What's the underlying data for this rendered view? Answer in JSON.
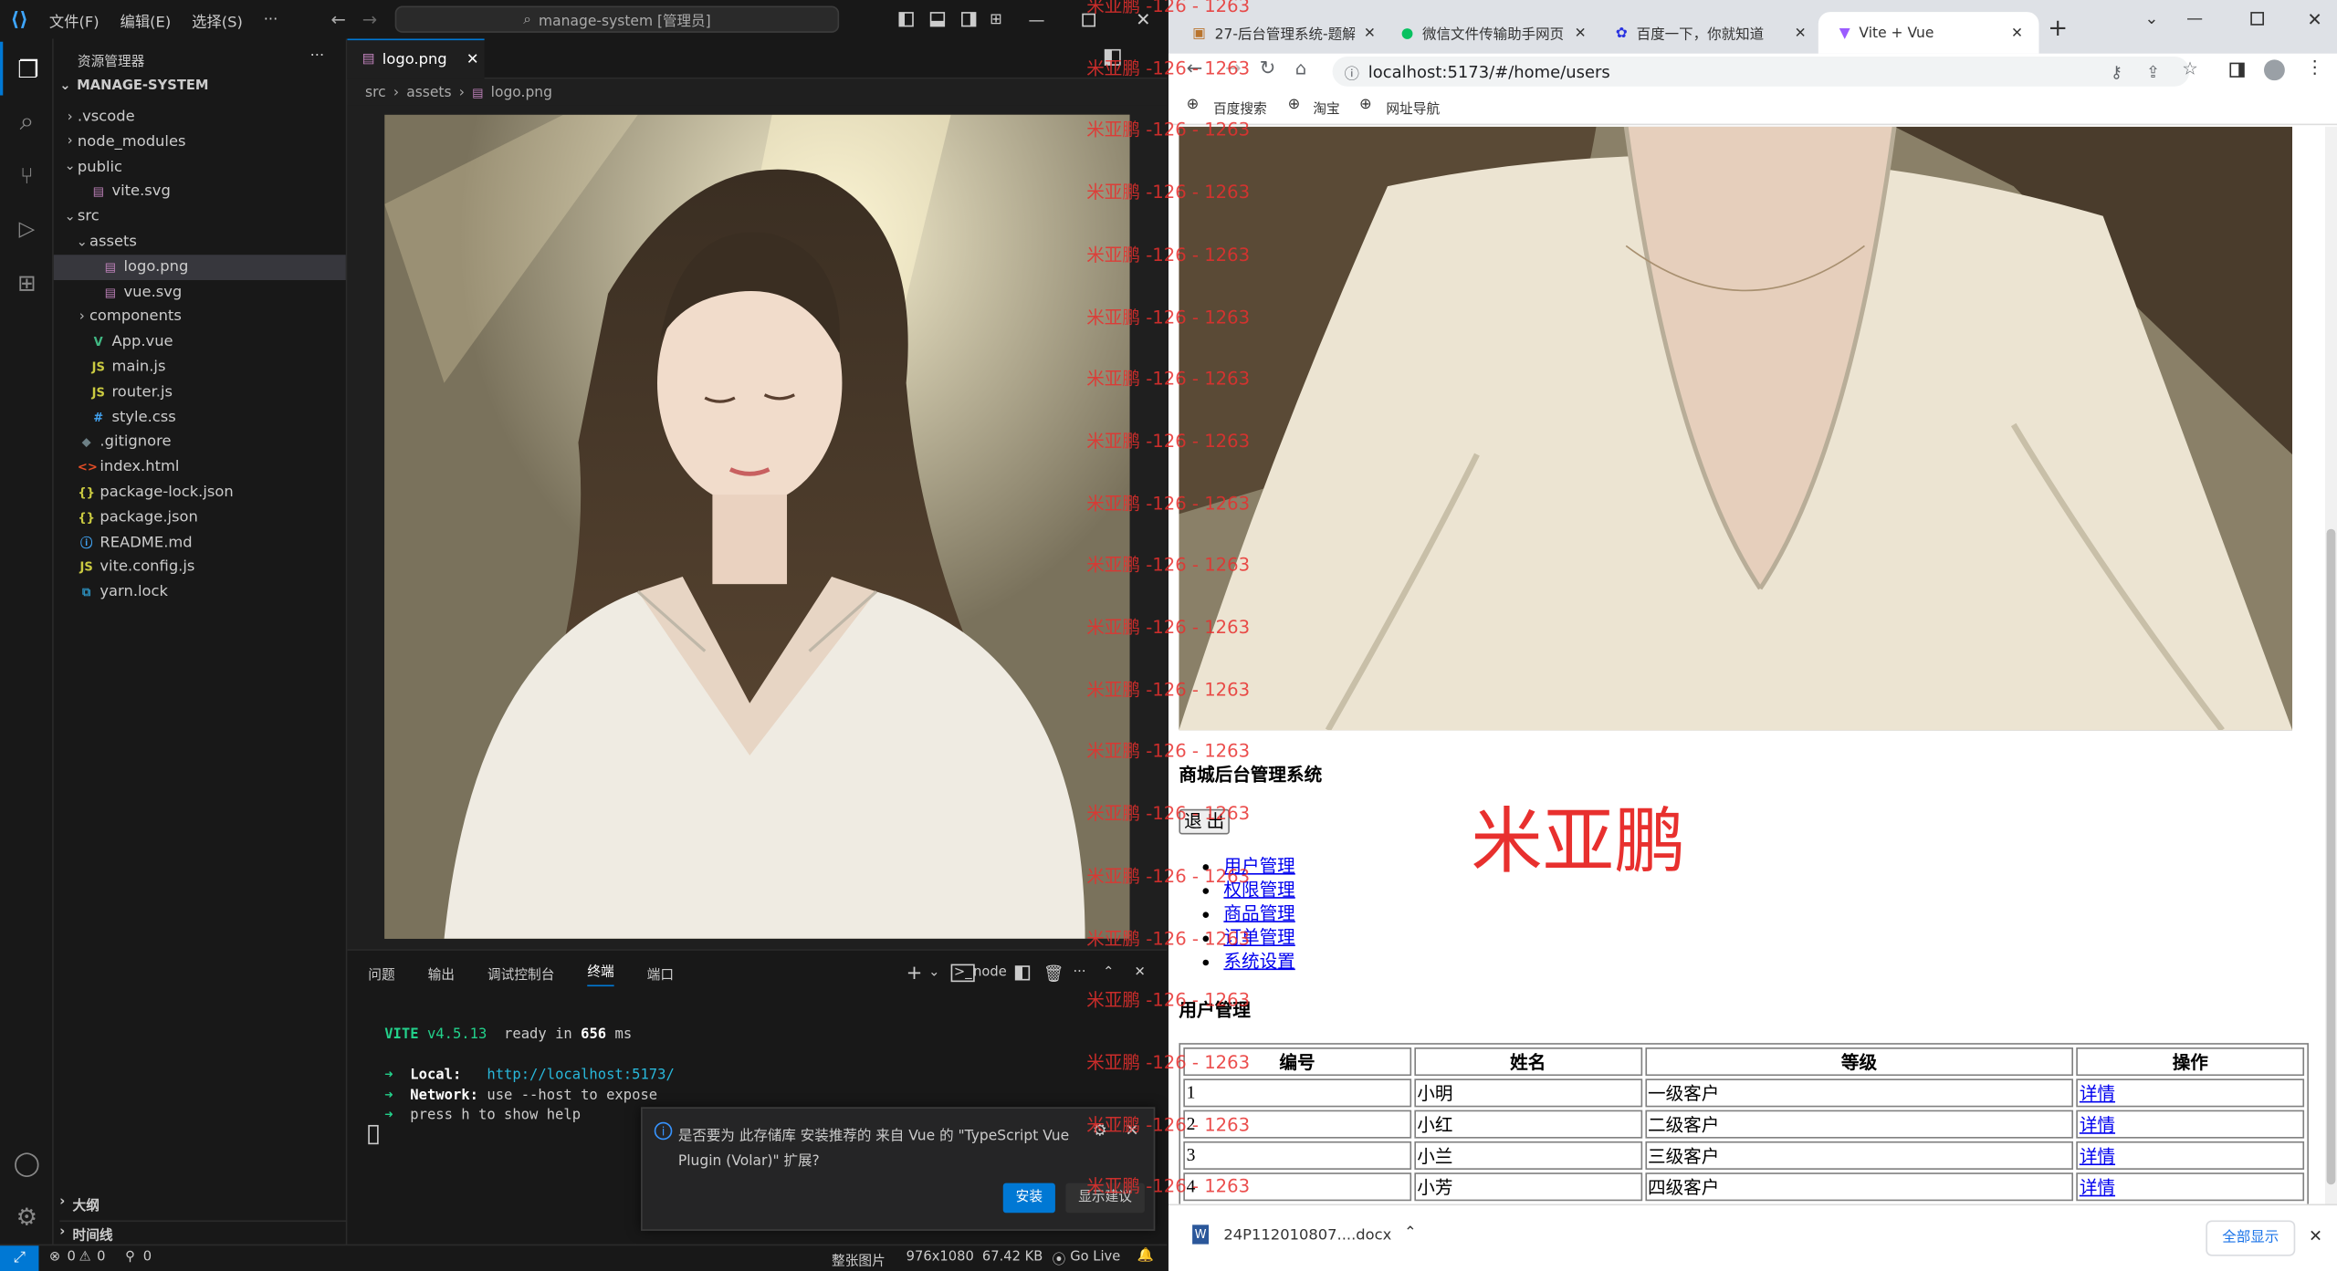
{
  "vscode": {
    "menus": [
      "文件(F)",
      "编辑(E)",
      "选择(S)",
      "···"
    ],
    "search_text": "manage-system [管理员]",
    "explorer_title": "资源管理器",
    "explorer_more": "···",
    "project_name": "MANAGE-SYSTEM",
    "tree": [
      {
        "label": ".vscode",
        "chev": "›",
        "indent": 0,
        "icon": "",
        "color": "#ccc"
      },
      {
        "label": "node_modules",
        "chev": "›",
        "indent": 0,
        "icon": "",
        "color": "#ccc"
      },
      {
        "label": "public",
        "chev": "⌄",
        "indent": 0,
        "icon": "",
        "color": "#ccc"
      },
      {
        "label": "vite.svg",
        "chev": "",
        "indent": 1,
        "icon": "▤",
        "color": "#c586c0"
      },
      {
        "label": "src",
        "chev": "⌄",
        "indent": 0,
        "icon": "",
        "color": "#ccc"
      },
      {
        "label": "assets",
        "chev": "⌄",
        "indent": 1,
        "icon": "",
        "color": "#ccc"
      },
      {
        "label": "logo.png",
        "chev": "",
        "indent": 2,
        "icon": "▤",
        "color": "#c586c0"
      },
      {
        "label": "vue.svg",
        "chev": "",
        "indent": 2,
        "icon": "▤",
        "color": "#c586c0"
      },
      {
        "label": "components",
        "chev": "›",
        "indent": 1,
        "icon": "",
        "color": "#ccc"
      },
      {
        "label": "App.vue",
        "chev": "",
        "indent": 1,
        "icon": "V",
        "color": "#41b883"
      },
      {
        "label": "main.js",
        "chev": "",
        "indent": 1,
        "icon": "JS",
        "color": "#cbcb41"
      },
      {
        "label": "router.js",
        "chev": "",
        "indent": 1,
        "icon": "JS",
        "color": "#cbcb41"
      },
      {
        "label": "style.css",
        "chev": "",
        "indent": 1,
        "icon": "#",
        "color": "#42a5f5"
      },
      {
        "label": ".gitignore",
        "chev": "",
        "indent": 0,
        "icon": "◆",
        "color": "#6d8086"
      },
      {
        "label": "index.html",
        "chev": "",
        "indent": 0,
        "icon": "<>",
        "color": "#e44d26"
      },
      {
        "label": "package-lock.json",
        "chev": "",
        "indent": 0,
        "icon": "{}",
        "color": "#cbcb41"
      },
      {
        "label": "package.json",
        "chev": "",
        "indent": 0,
        "icon": "{}",
        "color": "#cbcb41"
      },
      {
        "label": "README.md",
        "chev": "",
        "indent": 0,
        "icon": "ⓘ",
        "color": "#42a5f5"
      },
      {
        "label": "vite.config.js",
        "chev": "",
        "indent": 0,
        "icon": "JS",
        "color": "#cbcb41"
      },
      {
        "label": "yarn.lock",
        "chev": "",
        "indent": 0,
        "icon": "⧉",
        "color": "#2c8ebb"
      }
    ],
    "outline": "大纲",
    "timeline": "时间线",
    "tab_label": "logo.png",
    "breadcrumb": [
      "src",
      "assets",
      "logo.png"
    ],
    "panel_tabs": [
      "问题",
      "输出",
      "调试控制台",
      "终端",
      "端口"
    ],
    "panel_shell": "node",
    "terminal": {
      "vite": "VITE",
      "version": "v4.5.13",
      "ready": "ready in",
      "ms_value": "656",
      "ms_unit": "ms",
      "local_label": "Local:",
      "local_url": "http://localhost:5173/",
      "network_label": "Network:",
      "network_text": "use --host to expose",
      "help_text": "press h to show help"
    },
    "notification": {
      "line1": "是否要为 此存储库 安装推荐的 来自 Vue 的 \"TypeScript Vue",
      "line2": "Plugin (Volar)\" 扩展?",
      "install": "安装",
      "show": "显示建议"
    },
    "status": {
      "errors": "0",
      "warnings": "0",
      "ports": "0",
      "image_mode": "整张图片",
      "dimensions": "976x1080",
      "size": "67.42 KB",
      "golive": "Go Live"
    }
  },
  "chrome": {
    "tabs": [
      {
        "title": "27-后台管理系统-题解"
      },
      {
        "title": "微信文件传输助手网页"
      },
      {
        "title": "百度一下，你就知道"
      },
      {
        "title": "Vite + Vue"
      }
    ],
    "new_tab": "+",
    "url": "localhost:5173/#/home/users",
    "bookmarks": [
      "百度搜索",
      "淘宝",
      "网址导航"
    ],
    "download_file": "24P112010807....docx",
    "show_all": "全部显示"
  },
  "app": {
    "system_title": "商城后台管理系统",
    "logout": "退 出",
    "menu": [
      "用户管理",
      "权限管理",
      "商品管理",
      "订单管理",
      "系统设置"
    ],
    "section_title": "用户管理",
    "table_headers": [
      "编号",
      "姓名",
      "等级",
      "操作"
    ],
    "rows": [
      {
        "id": "1",
        "name": "小明",
        "level": "一级客户",
        "action": "详情"
      },
      {
        "id": "2",
        "name": "小红",
        "level": "二级客户",
        "action": "详情"
      },
      {
        "id": "3",
        "name": "小兰",
        "level": "三级客户",
        "action": "详情"
      },
      {
        "id": "4",
        "name": "小芳",
        "level": "四级客户",
        "action": "详情"
      }
    ],
    "big_name": "米亚鹏"
  },
  "watermark": "米亚鹏 -126 - 1263",
  "colors": {
    "accent": "#0078d4",
    "watermark": "#e8302e",
    "link": "#0000ee"
  }
}
